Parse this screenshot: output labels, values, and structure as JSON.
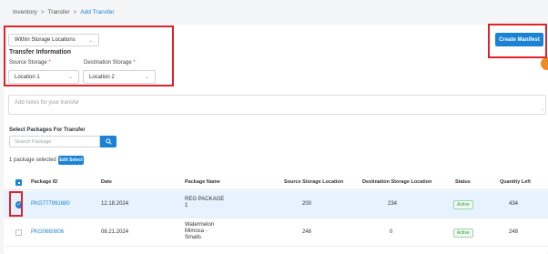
{
  "breadcrumb": [
    "Inventory",
    "Transfer",
    "Add Transfer"
  ],
  "breadcrumb_separator": ">",
  "transfer_mode": {
    "selected": "Within Storage Locations"
  },
  "section_title": "Transfer Information",
  "source": {
    "label": "Source Storage",
    "required_mark": "*",
    "selected": "Location 1"
  },
  "destination": {
    "label": "Destination Storage",
    "required_mark": "*",
    "selected": "Location 2"
  },
  "create_manifest_label": "Create Manifest",
  "notes_placeholder": "Add notes for your transfer",
  "packages": {
    "title": "Select Packages For Transfer",
    "search_placeholder": "Search Package",
    "selected_count_text": "1 package selected",
    "edit_label": "Edit Select"
  },
  "table": {
    "columns": [
      "Package ID",
      "Date",
      "Package Name",
      "Source Storage Location",
      "Destination Storage Location",
      "Status",
      "Quantity Left"
    ],
    "rows": [
      {
        "selected": true,
        "id": "PKG777991680",
        "date": "12.18.2024",
        "name": "REG PACKAGE 1",
        "source_qty": "200",
        "dest_qty": "234",
        "status": "Active",
        "qty_left": "434"
      },
      {
        "selected": false,
        "id": "PKG0660806",
        "date": "08.21.2024",
        "name": "Watermelon Mimosa - Smalls",
        "source_qty": "248",
        "dest_qty": "0",
        "status": "Active",
        "qty_left": "248"
      }
    ]
  },
  "colors": {
    "accent": "#1a82d6",
    "highlight_outline": "#e0232a",
    "active_status": "#2e9a4a",
    "selected_row": "#e6f2fd"
  },
  "icons": {
    "search": "search-icon",
    "dropdown": "chevron-down-icon",
    "checkbox": "check-icon"
  }
}
